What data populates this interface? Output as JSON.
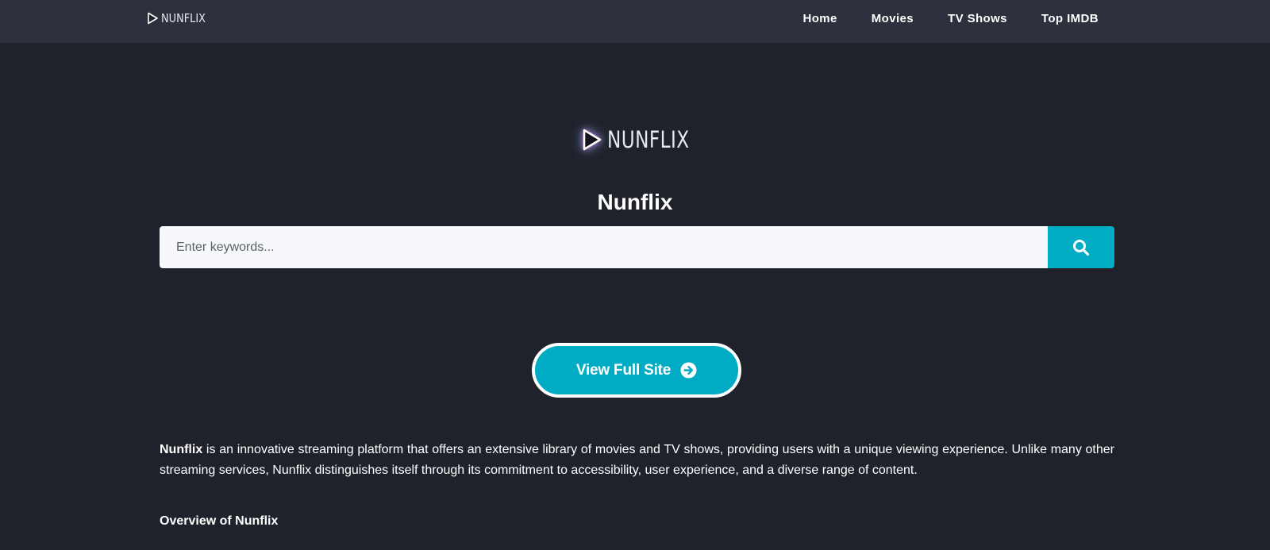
{
  "header": {
    "brand": "NUNFLIX",
    "nav": [
      {
        "label": "Home"
      },
      {
        "label": "Movies"
      },
      {
        "label": "TV Shows"
      },
      {
        "label": "Top IMDB"
      }
    ]
  },
  "hero": {
    "logo_text": "NUNFLIX",
    "logo_icon": "play-icon",
    "title": "Nunflix"
  },
  "search": {
    "placeholder": "Enter keywords...",
    "value": "",
    "button_icon": "search-icon"
  },
  "cta": {
    "label": "View Full Site",
    "icon": "arrow-right-circle-icon"
  },
  "article": {
    "intro_bold": "Nunflix",
    "intro_rest": " is an innovative streaming platform that offers an extensive library of movies and TV shows, providing users with a unique viewing experience. Unlike many other streaming services, Nunflix distinguishes itself through its commitment to accessibility, user experience, and a diverse range of content.",
    "overview_heading": "Overview of Nunflix"
  },
  "colors": {
    "page_bg": "#20222b",
    "header_bg": "#2d313e",
    "accent": "#00abc4",
    "text": "#ffffff"
  }
}
